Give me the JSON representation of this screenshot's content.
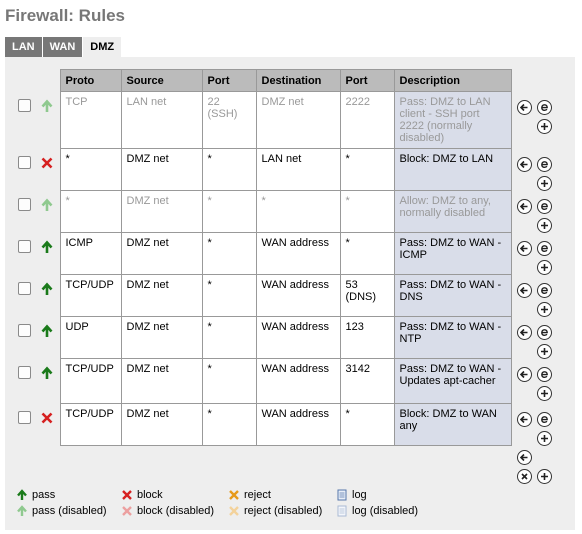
{
  "page": {
    "title": "Firewall: Rules"
  },
  "tabs": [
    {
      "label": "LAN",
      "active": false
    },
    {
      "label": "WAN",
      "active": false
    },
    {
      "label": "DMZ",
      "active": true
    }
  ],
  "table": {
    "headers": [
      "Proto",
      "Source",
      "Port",
      "Destination",
      "Port",
      "Description"
    ],
    "rows": [
      {
        "action": "pass",
        "disabled": true,
        "proto": "TCP",
        "source": "LAN net",
        "sport": "22 (SSH)",
        "destination": "DMZ net",
        "dport": "2222",
        "description": "Pass: DMZ to LAN client - SSH port 2222 (normally disabled)"
      },
      {
        "action": "block",
        "disabled": false,
        "proto": "*",
        "source": "DMZ net",
        "sport": "*",
        "destination": "LAN net",
        "dport": "*",
        "description": "Block: DMZ to LAN"
      },
      {
        "action": "pass",
        "disabled": true,
        "proto": "*",
        "source": "DMZ net",
        "sport": "*",
        "destination": "*",
        "dport": "*",
        "description": "Allow: DMZ to any, normally disabled"
      },
      {
        "action": "pass",
        "disabled": false,
        "proto": "ICMP",
        "source": "DMZ net",
        "sport": "*",
        "destination": "WAN address",
        "dport": "*",
        "description": "Pass: DMZ to WAN - ICMP"
      },
      {
        "action": "pass",
        "disabled": false,
        "proto": "TCP/UDP",
        "source": "DMZ net",
        "sport": "*",
        "destination": "WAN address",
        "dport": "53 (DNS)",
        "description": "Pass: DMZ to WAN - DNS"
      },
      {
        "action": "pass",
        "disabled": false,
        "proto": "UDP",
        "source": "DMZ net",
        "sport": "*",
        "destination": "WAN address",
        "dport": "123",
        "description": "Pass: DMZ to WAN - NTP"
      },
      {
        "action": "pass",
        "disabled": false,
        "proto": "TCP/UDP",
        "source": "DMZ net",
        "sport": "*",
        "destination": "WAN address",
        "dport": "3142",
        "description": "Pass: DMZ to WAN - Updates apt-cacher"
      },
      {
        "action": "block",
        "disabled": false,
        "proto": "TCP/UDP",
        "source": "DMZ net",
        "sport": "*",
        "destination": "WAN address",
        "dport": "*",
        "description": "Block: DMZ to WAN any"
      }
    ]
  },
  "legend": {
    "pass": "pass",
    "pass_disabled": "pass (disabled)",
    "block": "block",
    "block_disabled": "block (disabled)",
    "reject": "reject",
    "reject_disabled": "reject (disabled)",
    "log": "log",
    "log_disabled": "log (disabled)"
  },
  "colors": {
    "pass": "#1a7a1a",
    "pass_disabled": "#8fc98f",
    "block": "#d62020",
    "block_disabled": "#eca0a0",
    "reject": "#e69a1a",
    "reject_disabled": "#f3d29b",
    "header_bg": "#bbbbbb",
    "description_bg": "#d9dde9",
    "tab_bg": "#777777"
  }
}
